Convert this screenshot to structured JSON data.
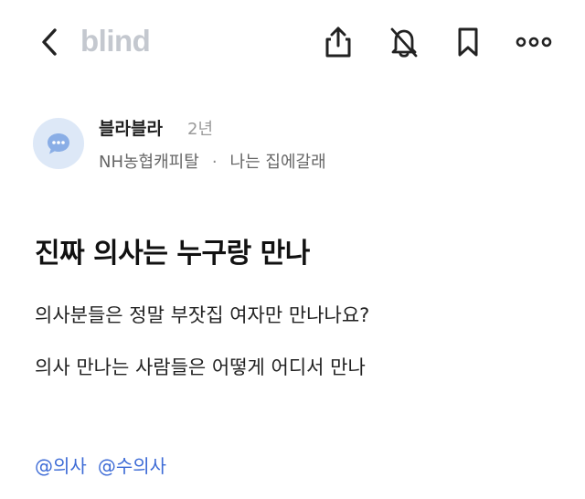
{
  "header": {
    "logo_text": "blind",
    "icons": [
      "chevron-left-icon",
      "share-icon",
      "bell-off-icon",
      "bookmark-icon",
      "more-icon"
    ]
  },
  "author": {
    "name": "블라블라",
    "age": "2년",
    "company": "NH농협캐피탈",
    "separator": "·",
    "nickname": "나는 집에갈래"
  },
  "post": {
    "title": "진짜 의사는 누구랑 만나",
    "lines": [
      "의사분들은 정말 부잣집 여자만 만나나요?",
      "의사 만나는 사람들은 어떻게 어디서 만나"
    ],
    "tags": [
      "@의사",
      "@수의사"
    ]
  },
  "colors": {
    "logo": "#c4c8cf",
    "avatar_bg": "#dde8f7",
    "avatar_icon": "#8aaee6",
    "tag": "#3d6bd6",
    "text": "#222222",
    "muted": "#9a9a9a"
  }
}
